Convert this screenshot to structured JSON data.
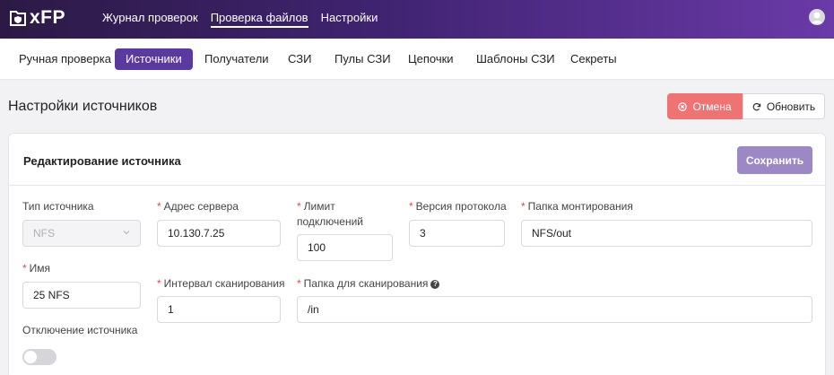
{
  "app": {
    "logo_text": "xFP"
  },
  "topnav": {
    "items": [
      {
        "label": "Журнал проверок"
      },
      {
        "label": "Проверка файлов",
        "active": true
      },
      {
        "label": "Настройки"
      }
    ]
  },
  "subnav": {
    "items": [
      {
        "label": "Ручная проверка"
      },
      {
        "label": "Источники",
        "active": true
      },
      {
        "label": "Получатели"
      },
      {
        "label": "СЗИ"
      },
      {
        "label": "Пулы СЗИ"
      },
      {
        "label": "Цепочки"
      },
      {
        "label": "Шаблоны СЗИ"
      },
      {
        "label": "Секреты"
      }
    ]
  },
  "page": {
    "title": "Настройки источников",
    "cancel_label": "Отмена",
    "refresh_label": "Обновить"
  },
  "card": {
    "title": "Редактирование источника",
    "save_label": "Сохранить"
  },
  "form": {
    "source_type": {
      "label": "Тип источника",
      "value": "NFS"
    },
    "server_address": {
      "label": "Адрес сервера",
      "value": "10.130.7.25"
    },
    "connection_limit": {
      "label_line1": "Лимит",
      "label_line2": "подключений",
      "value": "100"
    },
    "protocol_version": {
      "label": "Версия протокола",
      "value": "3"
    },
    "mount_folder": {
      "label": "Папка монтирования",
      "value": "NFS/out"
    },
    "name": {
      "label": "Имя",
      "value": "25 NFS"
    },
    "scan_interval": {
      "label": "Интервал сканирования",
      "value": "1"
    },
    "scan_folder": {
      "label": "Папка для сканирования",
      "value": "/in"
    },
    "disable_source": {
      "label": "Отключение источника",
      "enabled": false
    }
  },
  "colors": {
    "accent": "#5b3a9e",
    "cancel": "#f07373",
    "save": "#9c88c4",
    "required": "#e04848"
  },
  "icons": {
    "logo": "shield-folder-icon",
    "avatar": "user-avatar-icon",
    "cancel": "close-circle-icon",
    "refresh": "refresh-icon",
    "select": "chevron-down-icon",
    "help": "question-circle-icon"
  }
}
